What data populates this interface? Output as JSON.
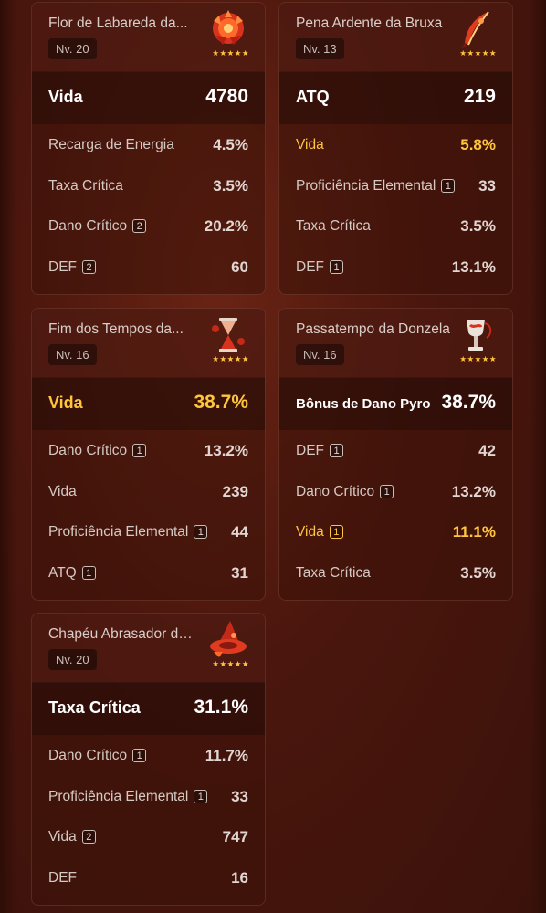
{
  "cards": [
    {
      "name": "Flor de Labareda da...",
      "level": "Nv. 20",
      "stars": "★★★★★",
      "art_icon": "flame-flower-icon",
      "main": {
        "label": "Vida",
        "value": "4780"
      },
      "subs": [
        {
          "label": "Recarga de Energia",
          "badge": "",
          "value": "4.5%"
        },
        {
          "label": "Taxa Crítica",
          "badge": "",
          "value": "3.5%"
        },
        {
          "label": "Dano Crítico",
          "badge": "2",
          "value": "20.2%"
        },
        {
          "label": "DEF",
          "badge": "2",
          "value": "60"
        }
      ]
    },
    {
      "name": "Pena Ardente da Bruxa",
      "level": "Nv. 13",
      "stars": "★★★★★",
      "art_icon": "burning-feather-icon",
      "main": {
        "label": "ATQ",
        "value": "219"
      },
      "subs": [
        {
          "label": "Vida",
          "badge": "",
          "value": "5.8%",
          "highlight": true
        },
        {
          "label": "Proficiência Elemental",
          "badge": "1",
          "value": "33"
        },
        {
          "label": "Taxa Crítica",
          "badge": "",
          "value": "3.5%"
        },
        {
          "label": "DEF",
          "badge": "1",
          "value": "13.1%"
        }
      ]
    },
    {
      "name": "Fim dos Tempos da...",
      "level": "Nv. 16",
      "stars": "★★★★★",
      "art_icon": "hourglass-icon",
      "main": {
        "label": "Vida",
        "value": "38.7%",
        "highlight": true
      },
      "subs": [
        {
          "label": "Dano Crítico",
          "badge": "1",
          "value": "13.2%"
        },
        {
          "label": "Vida",
          "badge": "",
          "value": "239"
        },
        {
          "label": "Proficiência Elemental",
          "badge": "1",
          "value": "44"
        },
        {
          "label": "ATQ",
          "badge": "1",
          "value": "31"
        }
      ]
    },
    {
      "name": "Passatempo da Donzela",
      "level": "Nv. 16",
      "stars": "★★★★★",
      "art_icon": "goblet-icon",
      "main": {
        "label": "Bônus de Dano Pyro",
        "value": "38.7%",
        "small": true
      },
      "subs": [
        {
          "label": "DEF",
          "badge": "1",
          "value": "42"
        },
        {
          "label": "Dano Crítico",
          "badge": "1",
          "value": "13.2%"
        },
        {
          "label": "Vida",
          "badge": "1",
          "value": "11.1%",
          "highlight": true
        },
        {
          "label": "Taxa Crítica",
          "badge": "",
          "value": "3.5%"
        }
      ]
    },
    {
      "name": "Chapéu Abrasador da...",
      "level": "Nv. 20",
      "stars": "★★★★★",
      "art_icon": "witch-hat-icon",
      "main": {
        "label": "Taxa Crítica",
        "value": "31.1%"
      },
      "subs": [
        {
          "label": "Dano Crítico",
          "badge": "1",
          "value": "11.7%"
        },
        {
          "label": "Proficiência Elemental",
          "badge": "1",
          "value": "33"
        },
        {
          "label": "Vida",
          "badge": "2",
          "value": "747"
        },
        {
          "label": "DEF",
          "badge": "",
          "value": "16"
        }
      ]
    }
  ],
  "colors": {
    "highlight": "#ffc53d",
    "text": "#e8ddd8",
    "background": "#4a160d"
  }
}
